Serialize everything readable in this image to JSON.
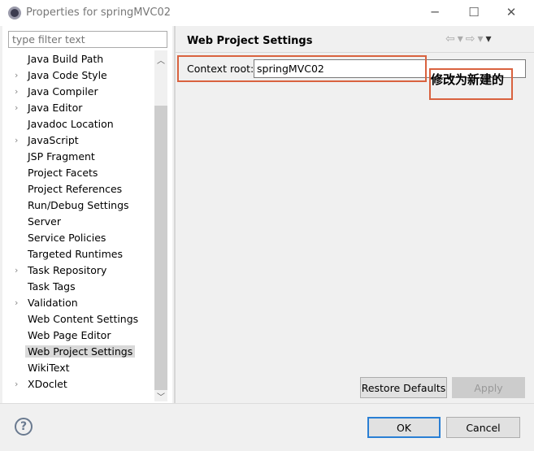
{
  "window": {
    "title": "Properties for springMVC02"
  },
  "filter": {
    "placeholder": "type filter text"
  },
  "tree": [
    {
      "label": "Java Build Path",
      "expandable": false
    },
    {
      "label": "Java Code Style",
      "expandable": true
    },
    {
      "label": "Java Compiler",
      "expandable": true
    },
    {
      "label": "Java Editor",
      "expandable": true
    },
    {
      "label": "Javadoc Location",
      "expandable": false
    },
    {
      "label": "JavaScript",
      "expandable": true
    },
    {
      "label": "JSP Fragment",
      "expandable": false
    },
    {
      "label": "Project Facets",
      "expandable": false
    },
    {
      "label": "Project References",
      "expandable": false
    },
    {
      "label": "Run/Debug Settings",
      "expandable": false
    },
    {
      "label": "Server",
      "expandable": false
    },
    {
      "label": "Service Policies",
      "expandable": false
    },
    {
      "label": "Targeted Runtimes",
      "expandable": false
    },
    {
      "label": "Task Repository",
      "expandable": true
    },
    {
      "label": "Task Tags",
      "expandable": false
    },
    {
      "label": "Validation",
      "expandable": true
    },
    {
      "label": "Web Content Settings",
      "expandable": false
    },
    {
      "label": "Web Page Editor",
      "expandable": false
    },
    {
      "label": "Web Project Settings",
      "expandable": false,
      "selected": true
    },
    {
      "label": "WikiText",
      "expandable": false
    },
    {
      "label": "XDoclet",
      "expandable": true
    }
  ],
  "page": {
    "title": "Web Project Settings",
    "context_label": "Context root:",
    "context_value": "springMVC02"
  },
  "annotation": {
    "text": "修改为新建的",
    "color": "#d9623f"
  },
  "buttons": {
    "restore": "Restore Defaults",
    "apply": "Apply",
    "ok": "OK",
    "cancel": "Cancel",
    "help": "?"
  }
}
